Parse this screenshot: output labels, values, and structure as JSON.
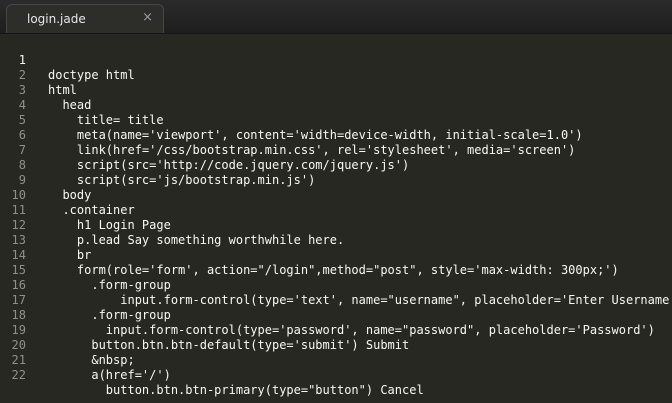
{
  "tab": {
    "title": "login.jade",
    "close_icon": "×"
  },
  "colors": {
    "background": "#272822",
    "text": "#f8f8f2",
    "gutter": "#90908a"
  },
  "lines": [
    {
      "num": "1",
      "text": "doctype html"
    },
    {
      "num": "2",
      "text": "html"
    },
    {
      "num": "3",
      "text": "  head"
    },
    {
      "num": "4",
      "text": "    title= title"
    },
    {
      "num": "5",
      "text": "    meta(name='viewport', content='width=device-width, initial-scale=1.0')"
    },
    {
      "num": "6",
      "text": "    link(href='/css/bootstrap.min.css', rel='stylesheet', media='screen')"
    },
    {
      "num": "7",
      "text": "    script(src='http://code.jquery.com/jquery.js')"
    },
    {
      "num": "8",
      "text": "    script(src='js/bootstrap.min.js')"
    },
    {
      "num": "9",
      "text": "  body"
    },
    {
      "num": "10",
      "text": "  .container"
    },
    {
      "num": "11",
      "text": "    h1 Login Page"
    },
    {
      "num": "12",
      "text": "    p.lead Say something worthwhile here."
    },
    {
      "num": "13",
      "text": "    br"
    },
    {
      "num": "14",
      "text": "    form(role='form', action=\"/login\",method=\"post\", style='max-width: 300px;')"
    },
    {
      "num": "15",
      "text": "      .form-group"
    },
    {
      "num": "16",
      "text": "          input.form-control(type='text', name=\"username\", placeholder='Enter Username')"
    },
    {
      "num": "17",
      "text": "      .form-group"
    },
    {
      "num": "18",
      "text": "        input.form-control(type='password', name=\"password\", placeholder='Password')"
    },
    {
      "num": "19",
      "text": "      button.btn.btn-default(type='submit') Submit"
    },
    {
      "num": "20",
      "text": "      &nbsp;"
    },
    {
      "num": "21",
      "text": "      a(href='/')"
    },
    {
      "num": "22",
      "text": "        button.btn.btn-primary(type=\"button\") Cancel"
    }
  ]
}
